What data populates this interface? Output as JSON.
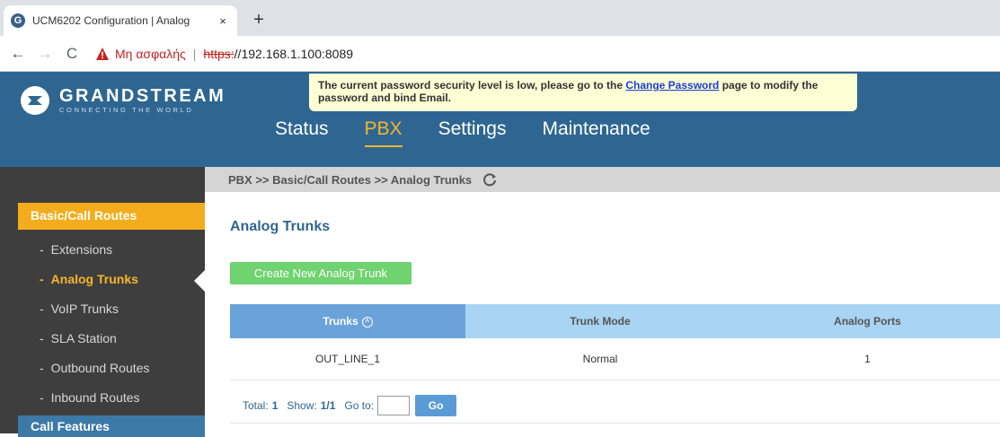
{
  "browser": {
    "tab_title": "UCM6202 Configuration | Analog",
    "tab_close": "×",
    "new_tab": "+",
    "back": "←",
    "forward": "→",
    "reload": "C",
    "insecure_label": "Μη ασφαλής",
    "separator": "|",
    "url_scheme": "https:",
    "url_rest": "//192.168.1.100:8089"
  },
  "header": {
    "logo_name": "GRANDSTREAM",
    "logo_tagline": "CONNECTING THE WORLD",
    "warning_prefix": "The current password security level is low, please go to the ",
    "warning_link": "Change Password",
    "warning_suffix": " page to modify the password and bind Email.",
    "nav": [
      "Status",
      "PBX",
      "Settings",
      "Maintenance"
    ]
  },
  "sidebar": {
    "section": "Basic/Call Routes",
    "items": [
      "Extensions",
      "Analog Trunks",
      "VoIP Trunks",
      "SLA Station",
      "Outbound Routes",
      "Inbound Routes"
    ],
    "next_section": "Call Features"
  },
  "content": {
    "breadcrumb": "PBX >> Basic/Call Routes >> Analog Trunks",
    "title": "Analog Trunks",
    "create_button": "Create New Analog Trunk",
    "table": {
      "headers": [
        "Trunks",
        "Trunk Mode",
        "Analog Ports"
      ],
      "rows": [
        [
          "OUT_LINE_1",
          "Normal",
          "1"
        ]
      ]
    },
    "pager": {
      "total_label": "Total:",
      "total": "1",
      "show_label": "Show:",
      "show": "1/1",
      "goto_label": "Go to:",
      "go_button": "Go"
    }
  },
  "icons": {
    "sort": "^"
  },
  "colors": {
    "header_blue": "#2f6691",
    "accent_orange": "#f7b52c",
    "create_green": "#6fd36f"
  }
}
